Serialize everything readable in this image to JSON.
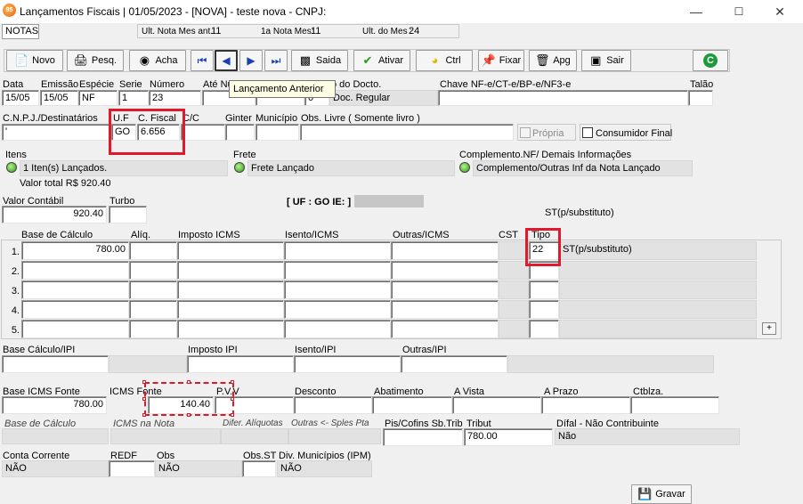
{
  "window": {
    "title": "Lançamentos Fiscais | 01/05/2023 - [NOVA] - teste nova - CNPJ:",
    "app_icon": "95",
    "minimize": "—",
    "maximize": "☐",
    "close": "✕"
  },
  "tab": "NOTAS",
  "info": {
    "ult_nota_mes_ant_label": "Ult. Nota Mes ant.:",
    "ult_nota_mes_ant_value": "11",
    "primeira_nota_mes_label": "1a Nota Mes:",
    "primeira_nota_mes_value": "11",
    "ult_do_mes_label": "Ult. do Mes :",
    "ult_do_mes_value": "24"
  },
  "toolbar": {
    "novo": "Novo",
    "pesq": "Pesq.",
    "acha": "Acha",
    "saida": "Saida",
    "ativar": "Ativar",
    "ctrl": "Ctrl",
    "fixar": "Fixar",
    "apg": "Apg",
    "sair": "Sair"
  },
  "tooltip": "Lançamento Anterior",
  "header": {
    "data_label": "Data",
    "data_value": "15/05",
    "emissao_label": "Emissão",
    "emissao_value": "15/05",
    "especie_label": "Espécie",
    "especie_value": "NF",
    "serie_label": "Serie",
    "serie_value": "1",
    "numero_label": "Número",
    "numero_value": "23",
    "ate_numero_label": "Até Nú",
    "tipo_docto_label": "o do Docto.",
    "tipo_docto_code": "0",
    "tipo_docto_value": "Doc. Regular",
    "chave_label": "Chave NF-e/CT-e/BP-e/NF3-e",
    "chave_value": "",
    "talao_label": "Talão",
    "talao_value": ""
  },
  "dest": {
    "cnpj_label": "C.N.P.J./Destinatários",
    "cnpj_value": "'",
    "uf_label": "U.F",
    "uf_value": "GO",
    "cfiscal_label": "C. Fiscal",
    "cfiscal_value": "6.656",
    "cc_label": "C/C",
    "ginter_label": "Ginter",
    "municipio_label": "Município",
    "obs_livre_label": "Obs. Livre ( Somente livro )",
    "propria_label": "Própria",
    "consumidor_final_label": "Consumidor Final"
  },
  "itens": {
    "label": "Itens",
    "value": "1 Iten(s) Lançados.",
    "valor_total": "Valor total R$ 920.40"
  },
  "frete": {
    "label": "Frete",
    "value": "Frete Lançado"
  },
  "complemento": {
    "label": "Complemento.NF/ Demais Informações",
    "value": "Complemento/Outras Inf da Nota Lançado"
  },
  "valores": {
    "valor_contabil_label": "Valor Contábil",
    "valor_contabil_value": "920.40",
    "turbo_label": "Turbo",
    "uf_ie_label": "[ UF : GO IE: ]",
    "st_substituto_label": "ST(p/substituto)"
  },
  "icms_grid": {
    "headers": {
      "base": "Base de Cálculo",
      "aliq": "Alíq.",
      "imposto": "Imposto ICMS",
      "isento": "Isento/ICMS",
      "outras": "Outras/ICMS",
      "cst": "CST",
      "tipo": "Tipo"
    },
    "rows": [
      {
        "num": "1.",
        "base": "780.00",
        "tipo": "22",
        "st": "ST(p/substituto)"
      },
      {
        "num": "2.",
        "base": "",
        "tipo": "",
        "st": ""
      },
      {
        "num": "3.",
        "base": "",
        "tipo": "",
        "st": ""
      },
      {
        "num": "4.",
        "base": "",
        "tipo": "",
        "st": ""
      },
      {
        "num": "5.",
        "base": "",
        "tipo": "",
        "st": ""
      }
    ],
    "plus": "+"
  },
  "ipi": {
    "base_label": "Base Cálculo/IPI",
    "imposto_label": "Imposto IPI",
    "isento_label": "Isento/IPI",
    "outras_label": "Outras/IPI"
  },
  "fonte": {
    "base_label": "Base ICMS Fonte",
    "base_value": "780.00",
    "icms_label": "ICMS Fonte",
    "icms_value": "140.40",
    "pvv_label": "P.V.V",
    "desconto_label": "Desconto",
    "abatimento_label": "Abatimento",
    "avista_label": "A Vista",
    "aprazo_label": "A Prazo",
    "ctblza_label": "Ctblza."
  },
  "difal": {
    "base_label": "Base de Cálculo",
    "icms_nota_label": "ICMS na Nota",
    "difer_label": "Difer. Alíquotas",
    "outras_label": "Outras <- Sples Pta",
    "piscofins_label": "Pis/Cofins Sb.Trib",
    "tribut_label": "Tribut",
    "tribut_value": "780.00",
    "difal_label": "Dífal - Não Contribuinte",
    "difal_value": "Não"
  },
  "footer": {
    "conta_corrente_label": "Conta Corrente",
    "conta_corrente_value": "NÃO",
    "redf_label": "REDF",
    "obs_label": "Obs",
    "obs_value": "NÃO",
    "obs_st_label": "Obs.ST",
    "div_municipios_label": "Div. Municípios (IPM)",
    "div_municipios_value": "NÃO",
    "gravar": "Gravar"
  }
}
